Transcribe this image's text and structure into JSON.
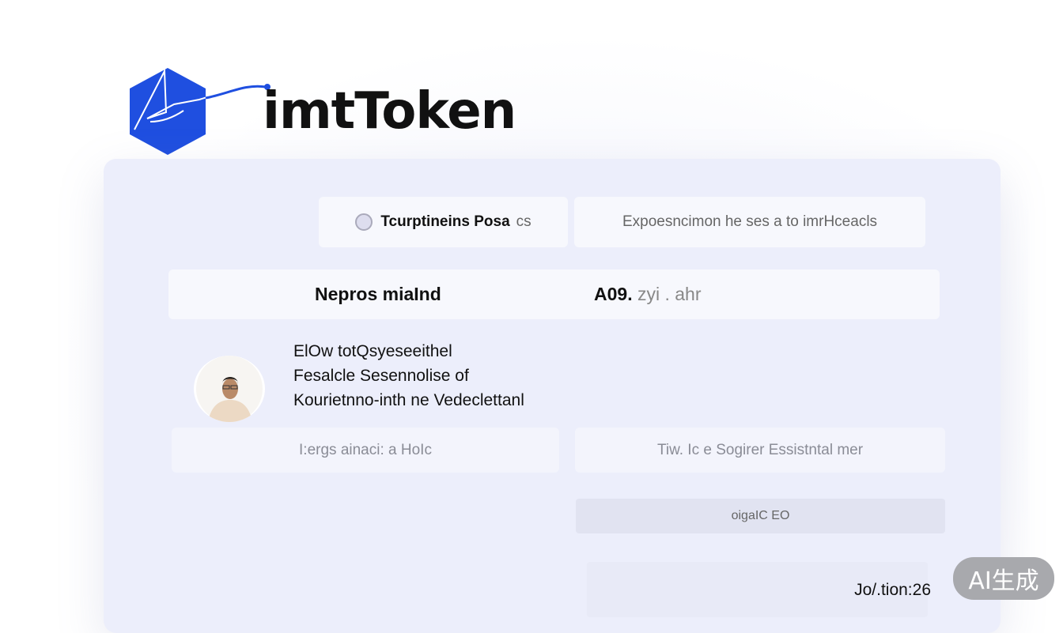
{
  "brand": {
    "name": "imtToken",
    "accent_color": "#1f4fe0"
  },
  "top_tabs": {
    "left_label": "Tcurptineins Posa",
    "left_suffix": "cs",
    "right_label": "Expoesncimon  he ses a to imrHceacls"
  },
  "summary_row": {
    "label": "Nepros miaInd",
    "value": "A09.",
    "value_suffix": "zyi . ahr"
  },
  "profile": {
    "avatar_icon": "person-avatar-icon",
    "description_lines": [
      "ElOw totQsyeseeithel",
      "Fesalcle Sesennolise of",
      "Kourietnno-inth ne Vedeclettanl"
    ]
  },
  "fields": {
    "left_placeholder": "I:ergs ainaci:  a HoIc",
    "right_placeholder": "Tiw. Ic e  Sogirer Essistntal  mer"
  },
  "action_button": {
    "label": "oigaIC EO"
  },
  "footer_field": {
    "text": "Jo/.tion:26"
  },
  "watermark": {
    "label": "AI生成"
  }
}
